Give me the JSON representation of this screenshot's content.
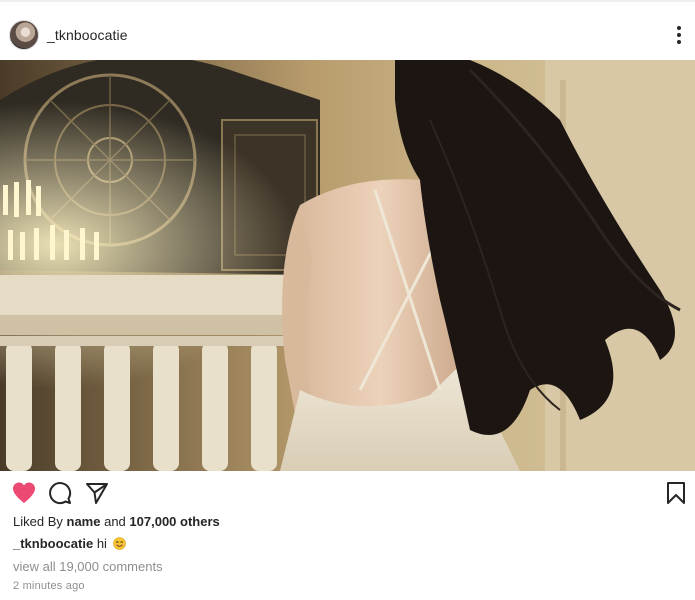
{
  "post": {
    "username": "_tknboocatie",
    "likes": {
      "prefix": "Liked By",
      "name": "name",
      "connector": "and",
      "others": "107,000 others"
    },
    "caption": {
      "username": "_tknboocatie",
      "text": "hi"
    },
    "comments_link": "view all 19,000 comments",
    "timestamp": "2 minutes ago"
  },
  "icons": {
    "more": "more-vertical-icon",
    "like": "heart-icon",
    "comment": "comment-icon",
    "share": "send-icon",
    "save": "bookmark-icon",
    "caption_emoji": "smiling-face-emoji"
  },
  "colors": {
    "like_active": "#ed4a73",
    "text_primary": "#262626",
    "text_secondary": "#8e8e8e"
  }
}
